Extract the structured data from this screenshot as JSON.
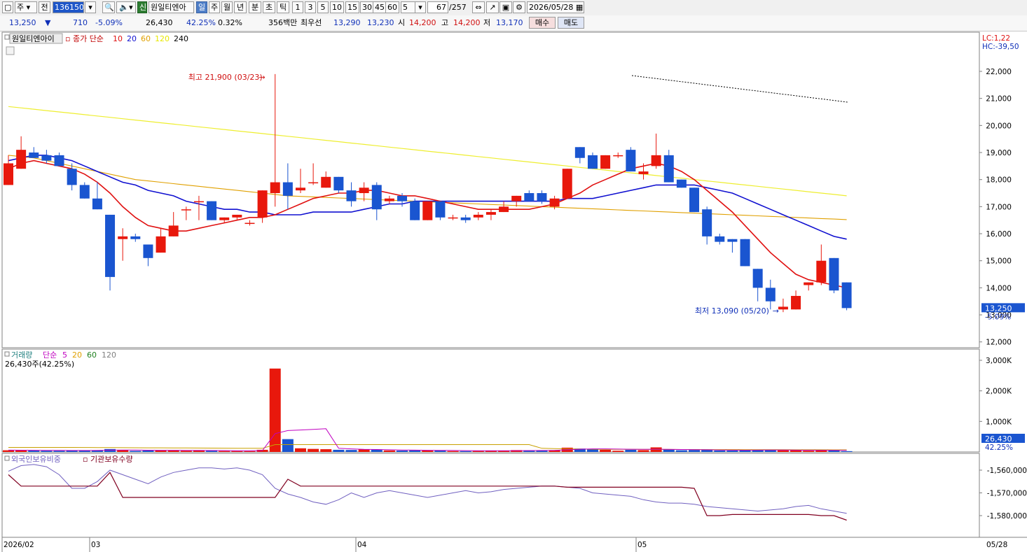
{
  "toolbar": {
    "type_select": "주",
    "prev_label": "전",
    "code_value": "136150",
    "stock_name": "원일티엔아",
    "credit_badge": "신",
    "periods": [
      "일",
      "주",
      "월",
      "년",
      "분",
      "초",
      "틱"
    ],
    "selected_period": "일",
    "minute_options": [
      "1",
      "3",
      "5",
      "10",
      "15",
      "30",
      "45",
      "60"
    ],
    "count_value": "5",
    "page_counter": "67",
    "page_total": "/257",
    "date_value": "2026/05/28"
  },
  "infobar": {
    "price": "13,250",
    "arrow": "▼",
    "change": "710",
    "change_pct": "-5.09%",
    "volume": "26,430",
    "volume_ratio": "42.25%",
    "turnover": "0.32%",
    "amount": "356백만",
    "best_ask_label": "최우선",
    "best_ask": "13,290",
    "best_bid": "13,230",
    "open_label": "시",
    "open": "14,200",
    "high_label": "고",
    "high": "14,200",
    "low_label": "저",
    "low": "13,170",
    "buy_label": "매수",
    "sell_label": "매도"
  },
  "price_panel": {
    "stock_label": "원일티엔아이",
    "ma_title": "종가 단순",
    "ma_periods": [
      "10",
      "20",
      "60",
      "120",
      "240"
    ],
    "ma_colors": [
      "#e01010",
      "#1010d0",
      "#e0a000",
      "#e8e800",
      "#000000"
    ],
    "lc": "LC:1,22",
    "hc": "HC:-39,50",
    "price_ticks": [
      "22,000",
      "21,000",
      "20,000",
      "19,000",
      "18,000",
      "17,000",
      "16,000",
      "15,000",
      "14,000",
      "13,000",
      "12,000"
    ],
    "current_price_box": "13,250",
    "current_pct": "-5.09%",
    "high_note": "최고 21,900 (03/23)",
    "low_note": "최저 13,090 (05/20)"
  },
  "volume_panel": {
    "title": "거래량",
    "ma_title": "단순",
    "ma_periods": [
      "5",
      "20",
      "60",
      "120"
    ],
    "ma_colors": [
      "#c000c0",
      "#e0a000",
      "#208020",
      "#808080"
    ],
    "sub_label": "26,430주(42.25%)",
    "ticks": [
      "3,000K",
      "2,000K",
      "1,000K"
    ],
    "current_box": "26,430",
    "current_pct": "42.25%"
  },
  "holding_panel": {
    "legend1": "외국인보유비중",
    "legend2": "기관보유수량",
    "legend1_color": "#7060c0",
    "legend2_color": "#800020",
    "ticks": [
      "-1,560,000",
      "-1,570,000",
      "-1,580,000"
    ]
  },
  "date_axis": {
    "labels": [
      "2026/02",
      "03",
      "04",
      "05"
    ],
    "right_label": "05/28"
  },
  "colors": {
    "up": "#e8180c",
    "down": "#1a55d0"
  },
  "chart_data": {
    "type": "candlestick",
    "ylim": [
      12000,
      22500
    ],
    "candles": [
      {
        "o": 17800,
        "h": 18900,
        "l": 17800,
        "c": 18600,
        "v": 55
      },
      {
        "o": 18400,
        "h": 19600,
        "l": 18400,
        "c": 19100,
        "v": 60
      },
      {
        "o": 19000,
        "h": 19200,
        "l": 18800,
        "c": 18800,
        "v": 45
      },
      {
        "o": 18900,
        "h": 19100,
        "l": 18600,
        "c": 18700,
        "v": 40
      },
      {
        "o": 18900,
        "h": 19000,
        "l": 18500,
        "c": 18500,
        "v": 38
      },
      {
        "o": 18400,
        "h": 18600,
        "l": 17600,
        "c": 17800,
        "v": 50
      },
      {
        "o": 17800,
        "h": 17900,
        "l": 17300,
        "c": 17300,
        "v": 48
      },
      {
        "o": 17300,
        "h": 17900,
        "l": 16900,
        "c": 16900,
        "v": 52
      },
      {
        "o": 16700,
        "h": 16700,
        "l": 13900,
        "c": 14400,
        "v": 95
      },
      {
        "o": 15800,
        "h": 16200,
        "l": 15000,
        "c": 15900,
        "v": 60
      },
      {
        "o": 15900,
        "h": 16000,
        "l": 15700,
        "c": 15800,
        "v": 35
      },
      {
        "o": 15600,
        "h": 15600,
        "l": 14800,
        "c": 15100,
        "v": 48
      },
      {
        "o": 15300,
        "h": 16200,
        "l": 15300,
        "c": 15900,
        "v": 55
      },
      {
        "o": 15900,
        "h": 16800,
        "l": 15900,
        "c": 16300,
        "v": 55
      },
      {
        "o": 16900,
        "h": 17000,
        "l": 16500,
        "c": 16900,
        "v": 40
      },
      {
        "o": 17200,
        "h": 17400,
        "l": 16500,
        "c": 17200,
        "v": 50
      },
      {
        "o": 17200,
        "h": 17200,
        "l": 16500,
        "c": 16500,
        "v": 42
      },
      {
        "o": 16500,
        "h": 16600,
        "l": 16400,
        "c": 16600,
        "v": 30
      },
      {
        "o": 16600,
        "h": 16700,
        "l": 16500,
        "c": 16700,
        "v": 30
      },
      {
        "o": 16400,
        "h": 16500,
        "l": 16300,
        "c": 16400,
        "v": 28
      },
      {
        "o": 16600,
        "h": 17600,
        "l": 16400,
        "c": 17600,
        "v": 70
      },
      {
        "o": 17500,
        "h": 21900,
        "l": 17000,
        "c": 17900,
        "v": 2730
      },
      {
        "o": 17900,
        "h": 18600,
        "l": 16900,
        "c": 17400,
        "v": 420
      },
      {
        "o": 17600,
        "h": 18400,
        "l": 17500,
        "c": 17700,
        "v": 120
      },
      {
        "o": 17900,
        "h": 18600,
        "l": 17800,
        "c": 17900,
        "v": 100
      },
      {
        "o": 17700,
        "h": 18300,
        "l": 17700,
        "c": 18100,
        "v": 90
      },
      {
        "o": 18100,
        "h": 18100,
        "l": 17500,
        "c": 17600,
        "v": 70
      },
      {
        "o": 17600,
        "h": 17900,
        "l": 17000,
        "c": 17200,
        "v": 65
      },
      {
        "o": 17500,
        "h": 17900,
        "l": 17200,
        "c": 17700,
        "v": 80
      },
      {
        "o": 17800,
        "h": 17900,
        "l": 16500,
        "c": 16900,
        "v": 75
      },
      {
        "o": 17200,
        "h": 17400,
        "l": 17100,
        "c": 17300,
        "v": 50
      },
      {
        "o": 17400,
        "h": 17500,
        "l": 17000,
        "c": 17200,
        "v": 45
      },
      {
        "o": 17200,
        "h": 17300,
        "l": 16500,
        "c": 16500,
        "v": 55
      },
      {
        "o": 16500,
        "h": 17200,
        "l": 16500,
        "c": 17200,
        "v": 50
      },
      {
        "o": 17200,
        "h": 17200,
        "l": 16500,
        "c": 16600,
        "v": 48
      },
      {
        "o": 16600,
        "h": 16700,
        "l": 16500,
        "c": 16600,
        "v": 30
      },
      {
        "o": 16600,
        "h": 16700,
        "l": 16400,
        "c": 16500,
        "v": 28
      },
      {
        "o": 16600,
        "h": 16800,
        "l": 16500,
        "c": 16700,
        "v": 32
      },
      {
        "o": 16700,
        "h": 16900,
        "l": 16500,
        "c": 16800,
        "v": 35
      },
      {
        "o": 16800,
        "h": 17200,
        "l": 16800,
        "c": 17000,
        "v": 45
      },
      {
        "o": 17200,
        "h": 17400,
        "l": 17000,
        "c": 17400,
        "v": 60
      },
      {
        "o": 17500,
        "h": 17600,
        "l": 17200,
        "c": 17200,
        "v": 55
      },
      {
        "o": 17500,
        "h": 17600,
        "l": 17100,
        "c": 17200,
        "v": 50
      },
      {
        "o": 17000,
        "h": 17400,
        "l": 16900,
        "c": 17300,
        "v": 60
      },
      {
        "o": 17300,
        "h": 18400,
        "l": 17300,
        "c": 18400,
        "v": 140
      },
      {
        "o": 19200,
        "h": 19200,
        "l": 18600,
        "c": 18800,
        "v": 110
      },
      {
        "o": 18900,
        "h": 19000,
        "l": 18400,
        "c": 18400,
        "v": 90
      },
      {
        "o": 18400,
        "h": 18900,
        "l": 18400,
        "c": 18900,
        "v": 70
      },
      {
        "o": 18900,
        "h": 19000,
        "l": 18800,
        "c": 18900,
        "v": 40
      },
      {
        "o": 19100,
        "h": 19200,
        "l": 18300,
        "c": 18300,
        "v": 70
      },
      {
        "o": 18200,
        "h": 18600,
        "l": 18000,
        "c": 18300,
        "v": 60
      },
      {
        "o": 18500,
        "h": 19700,
        "l": 18400,
        "c": 18900,
        "v": 150
      },
      {
        "o": 18900,
        "h": 19100,
        "l": 17900,
        "c": 17900,
        "v": 80
      },
      {
        "o": 18000,
        "h": 18000,
        "l": 17700,
        "c": 17700,
        "v": 55
      },
      {
        "o": 17700,
        "h": 17700,
        "l": 16800,
        "c": 16800,
        "v": 65
      },
      {
        "o": 16900,
        "h": 17000,
        "l": 15600,
        "c": 15900,
        "v": 75
      },
      {
        "o": 15900,
        "h": 16000,
        "l": 15600,
        "c": 15700,
        "v": 48
      },
      {
        "o": 15800,
        "h": 15800,
        "l": 15300,
        "c": 15700,
        "v": 45
      },
      {
        "o": 15800,
        "h": 15800,
        "l": 14800,
        "c": 14800,
        "v": 70
      },
      {
        "o": 14700,
        "h": 14700,
        "l": 13500,
        "c": 14000,
        "v": 72
      },
      {
        "o": 14000,
        "h": 14300,
        "l": 13200,
        "c": 13500,
        "v": 70
      },
      {
        "o": 13200,
        "h": 13600,
        "l": 13100,
        "c": 13300,
        "v": 55
      },
      {
        "o": 13200,
        "h": 13900,
        "l": 13200,
        "c": 13700,
        "v": 60
      },
      {
        "o": 14100,
        "h": 14200,
        "l": 13900,
        "c": 14200,
        "v": 40
      },
      {
        "o": 14200,
        "h": 15600,
        "l": 14100,
        "c": 15000,
        "v": 70
      },
      {
        "o": 15100,
        "h": 15100,
        "l": 13800,
        "c": 13900,
        "v": 55
      },
      {
        "o": 14200,
        "h": 14200,
        "l": 13170,
        "c": 13250,
        "v": 26.4
      }
    ],
    "ma10": [
      18400,
      18600,
      18700,
      18600,
      18500,
      18400,
      18200,
      17900,
      17500,
      17000,
      16600,
      16300,
      16200,
      16100,
      16100,
      16200,
      16300,
      16400,
      16500,
      16600,
      16600,
      16700,
      16900,
      17100,
      17300,
      17400,
      17500,
      17500,
      17600,
      17600,
      17500,
      17400,
      17400,
      17300,
      17200,
      17100,
      17000,
      16900,
      16900,
      16900,
      16900,
      16900,
      17000,
      17100,
      17300,
      17500,
      17800,
      18000,
      18200,
      18400,
      18500,
      18600,
      18500,
      18300,
      18000,
      17600,
      17200,
      16800,
      16300,
      15800,
      15300,
      14900,
      14500,
      14300,
      14200,
      14100,
      14000
    ],
    "ma20": [
      18700,
      18800,
      18900,
      18900,
      18800,
      18700,
      18500,
      18300,
      18100,
      17900,
      17800,
      17600,
      17500,
      17400,
      17200,
      17100,
      17000,
      16900,
      16900,
      16800,
      16800,
      16700,
      16700,
      16700,
      16800,
      16800,
      16800,
      16800,
      16900,
      17000,
      17100,
      17100,
      17200,
      17200,
      17200,
      17200,
      17200,
      17200,
      17200,
      17200,
      17200,
      17200,
      17200,
      17200,
      17300,
      17300,
      17300,
      17400,
      17500,
      17600,
      17700,
      17800,
      17800,
      17800,
      17800,
      17700,
      17600,
      17500,
      17300,
      17100,
      16900,
      16700,
      16500,
      16300,
      16100,
      15900,
      15800
    ],
    "ma60": [
      18900,
      18850,
      18800,
      18700,
      18600,
      18500,
      18400,
      18300,
      18200,
      18100,
      18000,
      17950,
      17900,
      17850,
      17800,
      17750,
      17700,
      17650,
      17600,
      17550,
      17500,
      17450,
      17400,
      17380,
      17360,
      17340,
      17320,
      17300,
      17280,
      17260,
      17240,
      17220,
      17200,
      17180,
      17160,
      17140,
      17120,
      17100,
      17080,
      17060,
      17040,
      17020,
      17000,
      16980,
      16960,
      16940,
      16920,
      16900,
      16880,
      16860,
      16840,
      16820,
      16800,
      16780,
      16760,
      16740,
      16720,
      16700,
      16680,
      16660,
      16640,
      16620,
      16600,
      16580,
      16560,
      16540,
      16520
    ],
    "ma120": [
      20700,
      20650,
      20600,
      20550,
      20500,
      20450,
      20400,
      20350,
      20300,
      20250,
      20200,
      20150,
      20100,
      20050,
      20000,
      19950,
      19900,
      19850,
      19800,
      19750,
      19700,
      19650,
      19600,
      19550,
      19500,
      19450,
      19400,
      19350,
      19300,
      19250,
      19200,
      19150,
      19100,
      19050,
      19000,
      18950,
      18900,
      18850,
      18800,
      18750,
      18700,
      18650,
      18600,
      18550,
      18500,
      18450,
      18400,
      18350,
      18300,
      18250,
      18200,
      18150,
      18100,
      18050,
      18000,
      17950,
      17900,
      17850,
      17800,
      17750,
      17700,
      17650,
      17600,
      17550,
      17500,
      17450,
      17400
    ],
    "vol_ma5": [
      60,
      58,
      55,
      52,
      50,
      48,
      47,
      50,
      60,
      65,
      62,
      58,
      55,
      54,
      52,
      50,
      48,
      45,
      42,
      40,
      45,
      600,
      700,
      720,
      740,
      760,
      120,
      100,
      85,
      80,
      70,
      65,
      60,
      56,
      52,
      48,
      44,
      40,
      38,
      40,
      42,
      45,
      48,
      52,
      70,
      90,
      100,
      100,
      95,
      90,
      85,
      90,
      85,
      80,
      75,
      70,
      65,
      60,
      58,
      60,
      62,
      64,
      60,
      58,
      56,
      55,
      52
    ],
    "vol_ma20": [
      150,
      150,
      150,
      150,
      150,
      148,
      146,
      144,
      142,
      140,
      138,
      136,
      134,
      132,
      130,
      128,
      126,
      124,
      122,
      120,
      118,
      240,
      240,
      240,
      240,
      240,
      240,
      240,
      240,
      240,
      240,
      240,
      240,
      240,
      240,
      240,
      240,
      240,
      240,
      240,
      240,
      240,
      120,
      110,
      100,
      95,
      90,
      88,
      86,
      85,
      84,
      83,
      82,
      81,
      80,
      79,
      78,
      77,
      76,
      75,
      74,
      73,
      72,
      71,
      70,
      69,
      68
    ],
    "foreign_ratio": [
      -1560500,
      -1558000,
      -1557500,
      -1558500,
      -1562000,
      -1568000,
      -1568000,
      -1565000,
      -1560000,
      -1562000,
      -1564000,
      -1566000,
      -1563000,
      -1561000,
      -1560000,
      -1559000,
      -1559000,
      -1559500,
      -1559000,
      -1560000,
      -1562000,
      -1568000,
      -1570500,
      -1572000,
      -1574000,
      -1575000,
      -1573000,
      -1570000,
      -1572000,
      -1570000,
      -1569000,
      -1570000,
      -1571000,
      -1572000,
      -1571000,
      -1570000,
      -1569000,
      -1570000,
      -1569500,
      -1568500,
      -1568000,
      -1567500,
      -1567000,
      -1567000,
      -1567500,
      -1568000,
      -1570000,
      -1570500,
      -1571000,
      -1571500,
      -1573000,
      -1574000,
      -1574500,
      -1574500,
      -1575000,
      -1576000,
      -1576500,
      -1577000,
      -1577500,
      -1578000,
      -1577500,
      -1577000,
      -1576000,
      -1575500,
      -1577000,
      -1578000,
      -1579000
    ],
    "inst_qty": [
      -1562000,
      -1567000,
      -1567000,
      -1567000,
      -1567000,
      -1567000,
      -1567000,
      -1567000,
      -1561000,
      -1572000,
      -1572000,
      -1572000,
      -1572000,
      -1572000,
      -1572000,
      -1572000,
      -1572000,
      -1572000,
      -1572000,
      -1572000,
      -1572000,
      -1572000,
      -1564000,
      -1567000,
      -1567000,
      -1567000,
      -1567000,
      -1567000,
      -1567000,
      -1567000,
      -1567000,
      -1567000,
      -1567000,
      -1567000,
      -1567000,
      -1567000,
      -1567000,
      -1567000,
      -1567000,
      -1567000,
      -1567000,
      -1567000,
      -1567000,
      -1567000,
      -1567500,
      -1567500,
      -1567500,
      -1567500,
      -1567500,
      -1567500,
      -1567500,
      -1567500,
      -1567500,
      -1567500,
      -1568000,
      -1580000,
      -1580000,
      -1579500,
      -1579500,
      -1579500,
      -1579500,
      -1579500,
      -1579500,
      -1579500,
      -1580000,
      -1580000,
      -1582000
    ]
  }
}
